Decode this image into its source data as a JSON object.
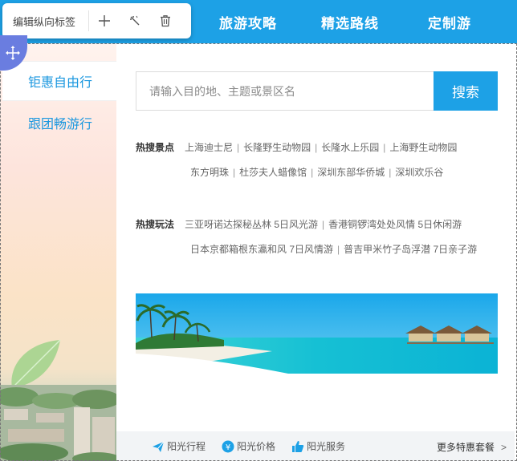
{
  "toolbar": {
    "label": "编辑纵向标签",
    "add_icon": "plus-icon",
    "style_icon": "magic-wand-icon",
    "delete_icon": "trash-icon"
  },
  "topnav": {
    "items": [
      "旅游攻略",
      "精选路线",
      "定制游"
    ]
  },
  "tabs": [
    {
      "label": "钜惠自由行",
      "active": true
    },
    {
      "label": "跟团畅游行",
      "active": false
    }
  ],
  "search": {
    "placeholder": "请输入目的地、主题或景区名",
    "button": "搜索"
  },
  "hot_spots": {
    "label": "热搜景点",
    "line1": [
      "上海迪士尼",
      "长隆野生动物园",
      "长隆水上乐园",
      "上海野生动物园"
    ],
    "line2": [
      "东方明珠",
      "杜莎夫人蜡像馆",
      "深圳东部华侨城",
      "深圳欢乐谷"
    ]
  },
  "hot_play": {
    "label": "热搜玩法",
    "line1": [
      "三亚呀诺达探秘丛林 5日风光游",
      "香港铜锣湾处处风情 5日休闲游"
    ],
    "line2": [
      "日本京都箱根东瀛和风 7日风情游",
      "普吉甲米竹子岛浮潜 7日亲子游"
    ]
  },
  "features": [
    {
      "icon": "paper-plane-icon",
      "label": "阳光行程"
    },
    {
      "icon": "yen-coin-icon",
      "label": "阳光价格"
    },
    {
      "icon": "thumbs-up-icon",
      "label": "阳光服务"
    }
  ],
  "more": {
    "label": "更多特惠套餐",
    "icon": "chevron-right-icon"
  },
  "colors": {
    "accent": "#1da1e6",
    "tab_text": "#1a97df",
    "bottom_bar": "#f2f4f6"
  }
}
